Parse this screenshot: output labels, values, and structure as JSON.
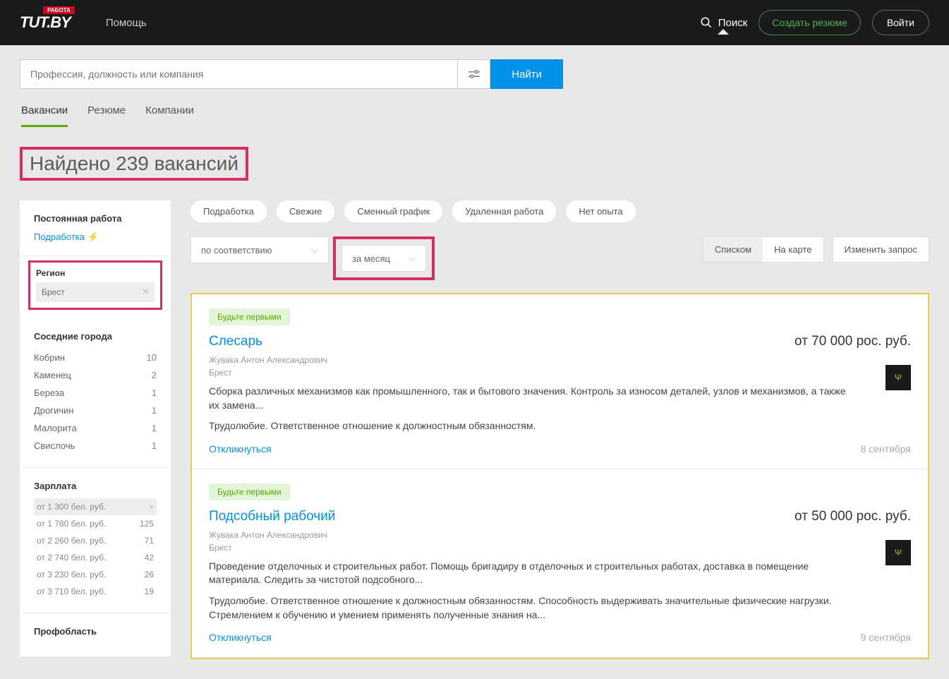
{
  "header": {
    "logo_badge": "РАБОТА",
    "logo_text": "TUT.BY",
    "help": "Помощь",
    "search": "Поиск",
    "create_resume": "Создать резюме",
    "login": "Войти"
  },
  "search": {
    "placeholder": "Профессия, должность или компания",
    "button": "Найти"
  },
  "tabs": {
    "vacancies": "Вакансии",
    "resumes": "Резюме",
    "companies": "Компании"
  },
  "page_title": "Найдено 239 вакансий",
  "sidebar": {
    "permanent": "Постоянная работа",
    "parttime": "Подработка",
    "region_label": "Регион",
    "region_value": "Брест",
    "neighbors_title": "Соседние города",
    "neighbors": [
      {
        "name": "Кобрин",
        "count": "10"
      },
      {
        "name": "Каменец",
        "count": "2"
      },
      {
        "name": "Береза",
        "count": "1"
      },
      {
        "name": "Дрогичин",
        "count": "1"
      },
      {
        "name": "Малорита",
        "count": "1"
      },
      {
        "name": "Свислочь",
        "count": "1"
      }
    ],
    "salary_title": "Зарплата",
    "salaries": [
      {
        "label": "от 1 300 бел. руб.",
        "count": "",
        "selected": true
      },
      {
        "label": "от 1 780 бел. руб.",
        "count": "125"
      },
      {
        "label": "от 2 260 бел. руб.",
        "count": "71"
      },
      {
        "label": "от 2 740 бел. руб.",
        "count": "42"
      },
      {
        "label": "от 3 230 бел. руб.",
        "count": "26"
      },
      {
        "label": "от 3 710 бел. руб.",
        "count": "19"
      }
    ],
    "profarea_title": "Профобласть"
  },
  "chips": [
    "Подработка",
    "Свежие",
    "Сменный график",
    "Удаленная работа",
    "Нет опыта"
  ],
  "sort": "по соответствию",
  "period": "за месяц",
  "view": {
    "list": "Списком",
    "map": "На карте",
    "modify": "Изменить запрос"
  },
  "vacancies": [
    {
      "badge": "Будьте первыми",
      "title": "Слесарь",
      "salary": "от 70 000 рос. руб.",
      "company": "Жувака Антон Александрович",
      "city": "Брест",
      "desc1": "Сборка различных механизмов как промышленного, так и бытового значения. Контроль за износом деталей, узлов и механизмов, а также их замена...",
      "desc2": "Трудолюбие. Ответственное отношение к должностным обязанностям.",
      "apply": "Откликнуться",
      "date": "8 сентября"
    },
    {
      "badge": "Будьте первыми",
      "title": "Подсобный рабочий",
      "salary": "от 50 000 рос. руб.",
      "company": "Жувака Антон Александрович",
      "city": "Брест",
      "desc1": "Проведение отделочных и строительных работ. Помощь бригадиру в отделочных и строительных работах, доставка в помещение материала. Следить за чистотой подсобного...",
      "desc2": "Трудолюбие. Ответственное отношение к должностным обязанностям. Способность выдерживать значительные физические нагрузки. Стремлением к обучению и умением применять полученные знания на...",
      "apply": "Откликнуться",
      "date": "9 сентября"
    }
  ]
}
